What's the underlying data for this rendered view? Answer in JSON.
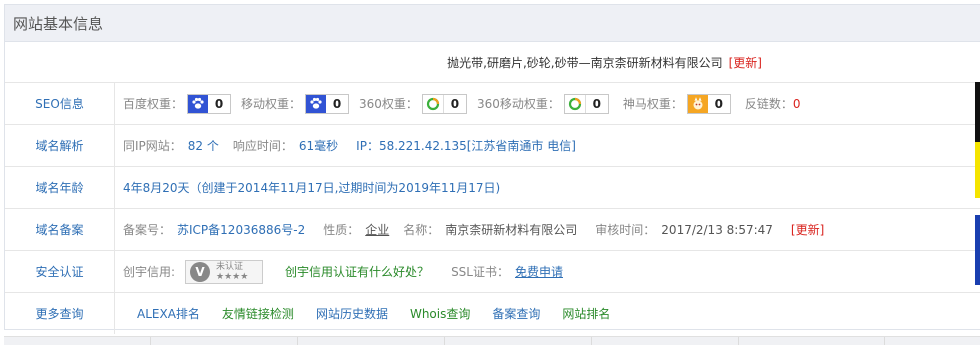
{
  "panel": {
    "title": "网站基本信息"
  },
  "site": {
    "title": "抛光带,研磨片,砂轮,砂带—南京柰研新材料有限公司",
    "update": "[更新]"
  },
  "seo": {
    "label": "SEO信息",
    "baidu_label": "百度权重：",
    "baidu_value": "0",
    "mobile_label": "移动权重：",
    "mobile_value": "0",
    "s360_label": "360权重：",
    "s360_value": "0",
    "s360m_label": "360移动权重：",
    "s360m_value": "0",
    "shenma_label": "神马权重：",
    "shenma_value": "0",
    "backlinks_label": "反链数：",
    "backlinks_value": "0"
  },
  "dns": {
    "label": "域名解析",
    "sameip_label": "同IP网站：",
    "sameip_value": "82 个",
    "resp_label": "响应时间：",
    "resp_value": "61毫秒",
    "ip_text": "IP：58.221.42.135[江苏省南通市 电信]"
  },
  "age": {
    "label": "域名年龄",
    "text": "4年8月20天（创建于2014年11月17日,过期时间为2019年11月17日)"
  },
  "icp": {
    "label": "域名备案",
    "no_label": "备案号：",
    "no_value": "苏ICP备12036886号-2",
    "type_label": "性质：",
    "type_value": "企业",
    "name_label": "名称：",
    "name_value": "南京柰研新材料有限公司",
    "time_label": "审核时间：",
    "time_value": "2017/2/13 8:57:47",
    "update": "[更新]"
  },
  "security": {
    "label": "安全认证",
    "credit_label": "创宇信用:",
    "cert_text": "未认证",
    "cert_stars": "★★★★",
    "credit_link": "创宇信用认证有什么好处？",
    "ssl_label": "SSL证书：",
    "ssl_link": "免费申请"
  },
  "more": {
    "label": "更多查询",
    "links": [
      "ALEXA排名",
      "友情链接检测",
      "网站历史数据",
      "Whois查询",
      "备案查询",
      "网站排名"
    ]
  },
  "colors": {
    "link_blue": "#2f6fb5",
    "link_green": "#2a8a2a",
    "alert_red": "#d9231e",
    "header_bg": "#eef0f5"
  },
  "icons": [
    "baidu-paw-icon",
    "360-icon",
    "shenma-icon",
    "verify-v-icon"
  ]
}
